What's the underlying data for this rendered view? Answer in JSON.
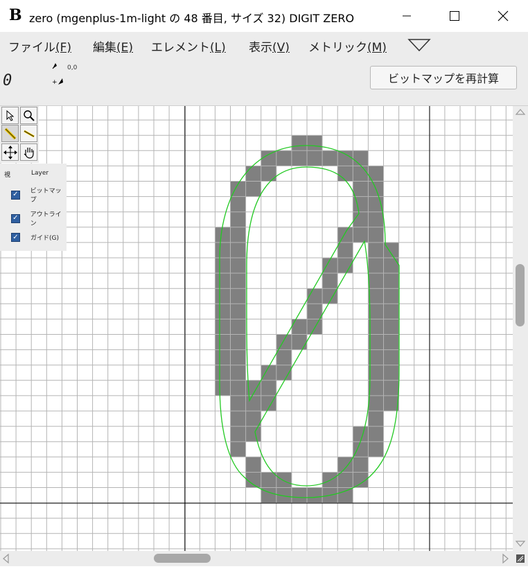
{
  "window": {
    "app_icon_letter": "B",
    "title": "zero (mgenplus-1m-light の 48 番目, サイズ 32) DIGIT ZERO",
    "minimize_glyph": "—",
    "maximize_glyph": "☐",
    "close_glyph": "✕"
  },
  "menu": {
    "items": [
      {
        "label": "ファイル",
        "key": "(F)"
      },
      {
        "label": "編集",
        "key": "(E)"
      },
      {
        "label": "エレメント",
        "key": "(L)"
      },
      {
        "label": "表示",
        "key": "(V)"
      },
      {
        "label": "メトリック",
        "key": "(M)"
      }
    ],
    "more_icon": "triangle-down-icon"
  },
  "toolbar": {
    "glyph_preview": "0",
    "coord_readout": "0,0",
    "recalc_label": "ビットマップを再計算"
  },
  "tools": [
    {
      "name": "pointer-tool",
      "icon": "arrow-cursor-icon"
    },
    {
      "name": "magnify-tool",
      "icon": "magnifier-icon"
    },
    {
      "name": "pencil-tool",
      "icon": "pencil-icon"
    },
    {
      "name": "line-tool",
      "icon": "line-icon"
    },
    {
      "name": "shift-tool",
      "icon": "move-arrows-icon"
    },
    {
      "name": "scroll-tool",
      "icon": "hand-icon"
    }
  ],
  "layers": {
    "header_view": "視",
    "header_layer": "Layer",
    "items": [
      {
        "label": "ビットマップ",
        "checked": true
      },
      {
        "label": "アウトライン",
        "checked": true
      },
      {
        "label": "ガイド(G)",
        "checked": true
      }
    ]
  },
  "colors": {
    "pixel_fill": "#808080",
    "outline": "#22c922",
    "grid": "#b4b4b4",
    "axis": "#000000"
  }
}
